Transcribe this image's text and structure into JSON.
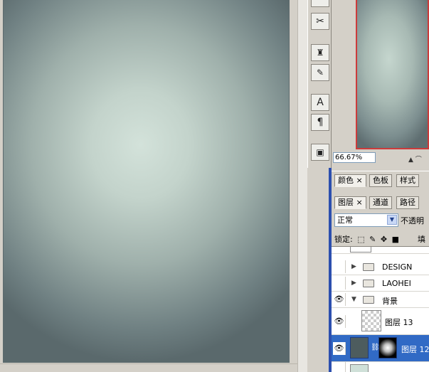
{
  "navigator": {
    "zoom": "66.67%"
  },
  "color_panel": {
    "tabs": [
      {
        "label": "颜色",
        "close": "×"
      },
      {
        "label": "色板"
      },
      {
        "label": "样式"
      }
    ]
  },
  "layers_panel": {
    "tabs": [
      {
        "label": "图层",
        "close": "×"
      },
      {
        "label": "通道"
      },
      {
        "label": "路径"
      }
    ],
    "blend_mode": "正常",
    "opacity_label": "不透明",
    "lock_label": "锁定:",
    "fill_label": "填",
    "layers": [
      {
        "name": "DESIGN",
        "type": "group",
        "expanded": false,
        "visible": false
      },
      {
        "name": "LAOHEI",
        "type": "group",
        "expanded": false,
        "visible": false
      },
      {
        "name": "背景",
        "type": "group",
        "expanded": true,
        "visible": true
      },
      {
        "name": "图层 13",
        "type": "layer",
        "visible": true
      },
      {
        "name": "图层 12",
        "type": "layer",
        "visible": true,
        "selected": true
      }
    ]
  },
  "colors": {
    "selection": "#316ac5",
    "accent_blue": "#2c4fae",
    "navigator_frame": "#cc3b3b"
  },
  "icons": [
    "crop-icon",
    "stamp-icon",
    "history-brush-icon",
    "text-tool-icon",
    "paragraph-icon",
    "screen-mode-icon"
  ]
}
